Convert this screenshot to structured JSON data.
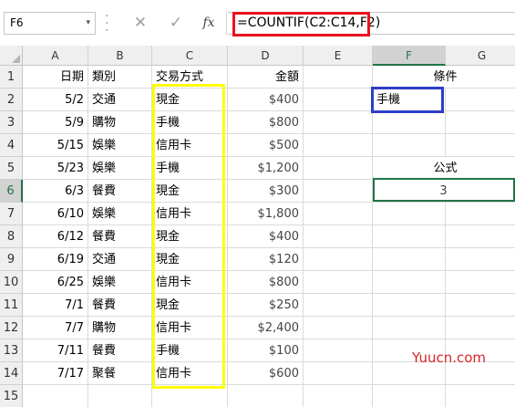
{
  "formula_bar": {
    "name_box": "F6",
    "name_box_arrow": "▾",
    "cancel_icon": "✕",
    "enter_icon": "✓",
    "fx_label": "fx",
    "formula": "=COUNTIF(C2:C14,F2)"
  },
  "columns": [
    "A",
    "B",
    "C",
    "D",
    "E",
    "F",
    "G"
  ],
  "rows": [
    "1",
    "2",
    "3",
    "4",
    "5",
    "6",
    "7",
    "8",
    "9",
    "10",
    "11",
    "12",
    "13",
    "14",
    "15"
  ],
  "headers": {
    "date": "日期",
    "category": "類別",
    "payment": "交易方式",
    "amount": "金額",
    "condition": "條件",
    "formula": "公式"
  },
  "records": [
    {
      "date": "5/2",
      "category": "交通",
      "payment": "現金",
      "amount": "$400"
    },
    {
      "date": "5/9",
      "category": "購物",
      "payment": "手機",
      "amount": "$800"
    },
    {
      "date": "5/15",
      "category": "娛樂",
      "payment": "信用卡",
      "amount": "$500"
    },
    {
      "date": "5/23",
      "category": "娛樂",
      "payment": "手機",
      "amount": "$1,200"
    },
    {
      "date": "6/3",
      "category": "餐費",
      "payment": "現金",
      "amount": "$300"
    },
    {
      "date": "6/10",
      "category": "娛樂",
      "payment": "信用卡",
      "amount": "$1,800"
    },
    {
      "date": "6/12",
      "category": "餐費",
      "payment": "現金",
      "amount": "$400"
    },
    {
      "date": "6/19",
      "category": "交通",
      "payment": "現金",
      "amount": "$120"
    },
    {
      "date": "6/25",
      "category": "娛樂",
      "payment": "信用卡",
      "amount": "$800"
    },
    {
      "date": "7/1",
      "category": "餐費",
      "payment": "現金",
      "amount": "$250"
    },
    {
      "date": "7/7",
      "category": "購物",
      "payment": "信用卡",
      "amount": "$2,400"
    },
    {
      "date": "7/11",
      "category": "餐費",
      "payment": "手機",
      "amount": "$100"
    },
    {
      "date": "7/17",
      "category": "聚餐",
      "payment": "信用卡",
      "amount": "$600"
    }
  ],
  "criteria": {
    "value": "手機"
  },
  "result": {
    "value": "3"
  },
  "watermark": "Yuucn.com",
  "colors": {
    "highlight_formula": "#e8141f",
    "highlight_range": "#ffff00",
    "highlight_criteria": "#2f3ec6",
    "selection": "#217346"
  }
}
